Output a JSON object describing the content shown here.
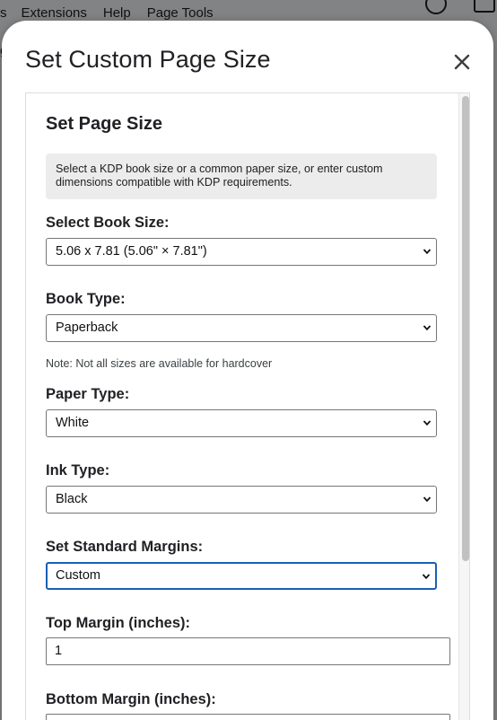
{
  "background": {
    "menu": [
      "s",
      "Extensions",
      "Help",
      "Page Tools"
    ],
    "edge_text": "g"
  },
  "dialog": {
    "title": "Set Custom Page Size",
    "close_icon": "close-icon"
  },
  "form": {
    "section_title": "Set Page Size",
    "info_text": "Select a KDP book size or a common paper size, or enter custom dimensions compatible with KDP requirements.",
    "book_size": {
      "label": "Select Book Size:",
      "value": "5.06 x 7.81 (5.06\" × 7.81\")"
    },
    "book_type": {
      "label": "Book Type:",
      "value": "Paperback"
    },
    "hardcover_note": "Note: Not all sizes are available for hardcover",
    "paper_type": {
      "label": "Paper Type:",
      "value": "White"
    },
    "ink_type": {
      "label": "Ink Type:",
      "value": "Black"
    },
    "margins": {
      "label": "Set Standard Margins:",
      "value": "Custom"
    },
    "top_margin": {
      "label": "Top Margin (inches):",
      "value": "1"
    },
    "bottom_margin": {
      "label": "Bottom Margin (inches):",
      "value": ""
    }
  },
  "colors": {
    "focus_border": "#1a5fb4",
    "info_bg": "#ececec",
    "scroll_thumb": "#c1c1c1"
  }
}
